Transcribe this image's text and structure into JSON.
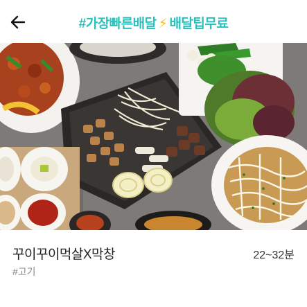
{
  "header": {
    "back_icon": "arrow-left-icon",
    "promo_left": "#가장빠른배달",
    "promo_icon": "lightning-bolt-icon",
    "promo_right": "배달팁무료"
  },
  "store": {
    "name": "꾸이꾸이먹살X막창",
    "delivery_time": "22~32분",
    "tag": "#고기"
  },
  "colors": {
    "accent": "#2ac1bc",
    "bolt": "#f5c518"
  }
}
